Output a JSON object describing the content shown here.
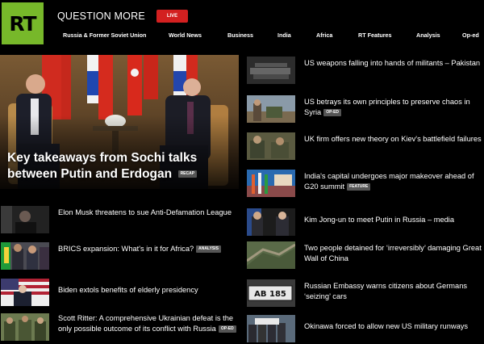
{
  "header": {
    "logo": "RT",
    "tagline": "QUESTION MORE",
    "live_label": "LIVE"
  },
  "nav": [
    "Russia & Former Soviet Union",
    "World News",
    "Business",
    "India",
    "Africa",
    "RT Features",
    "Analysis",
    "Op-ed"
  ],
  "hero": {
    "headline": "Key takeaways from Sochi talks between Putin and Erdogan",
    "badge": "RECAP"
  },
  "left_stories": [
    {
      "title": "Elon Musk threatens to sue Anti-Defamation League",
      "badge": ""
    },
    {
      "title": "BRICS expansion: What's in it for Africa?",
      "badge": "ANALYSIS"
    },
    {
      "title": "Biden extols benefits of elderly presidency",
      "badge": ""
    },
    {
      "title": "Scott Ritter: A comprehensive Ukrainian defeat is the only possible outcome of its conflict with Russia",
      "badge": "OP-ED"
    }
  ],
  "right_stories": [
    {
      "title": "US weapons falling into hands of militants – Pakistan",
      "badge": ""
    },
    {
      "title": "US betrays its own principles to preserve chaos in Syria",
      "badge": "OP-ED"
    },
    {
      "title": "UK firm offers new theory on Kiev's battlefield failures",
      "badge": ""
    },
    {
      "title": "India's capital undergoes major makeover ahead of G20 summit",
      "badge": "FEATURE"
    },
    {
      "title": "Kim Jong-un to meet Putin in Russia – media",
      "badge": ""
    },
    {
      "title": "Two people detained for ‘irreversibly’ damaging Great Wall of China",
      "badge": ""
    },
    {
      "title": "Russian Embassy warns citizens about Germans ‘seizing’ cars",
      "badge": ""
    },
    {
      "title": "Okinawa forced to allow new US military runways",
      "badge": ""
    }
  ],
  "thumb_texts": {
    "plate": "AB 185"
  },
  "colors": {
    "brand_green": "#77b82a",
    "live_red": "#d32020",
    "badge_gray": "#555555",
    "background": "#000000"
  }
}
